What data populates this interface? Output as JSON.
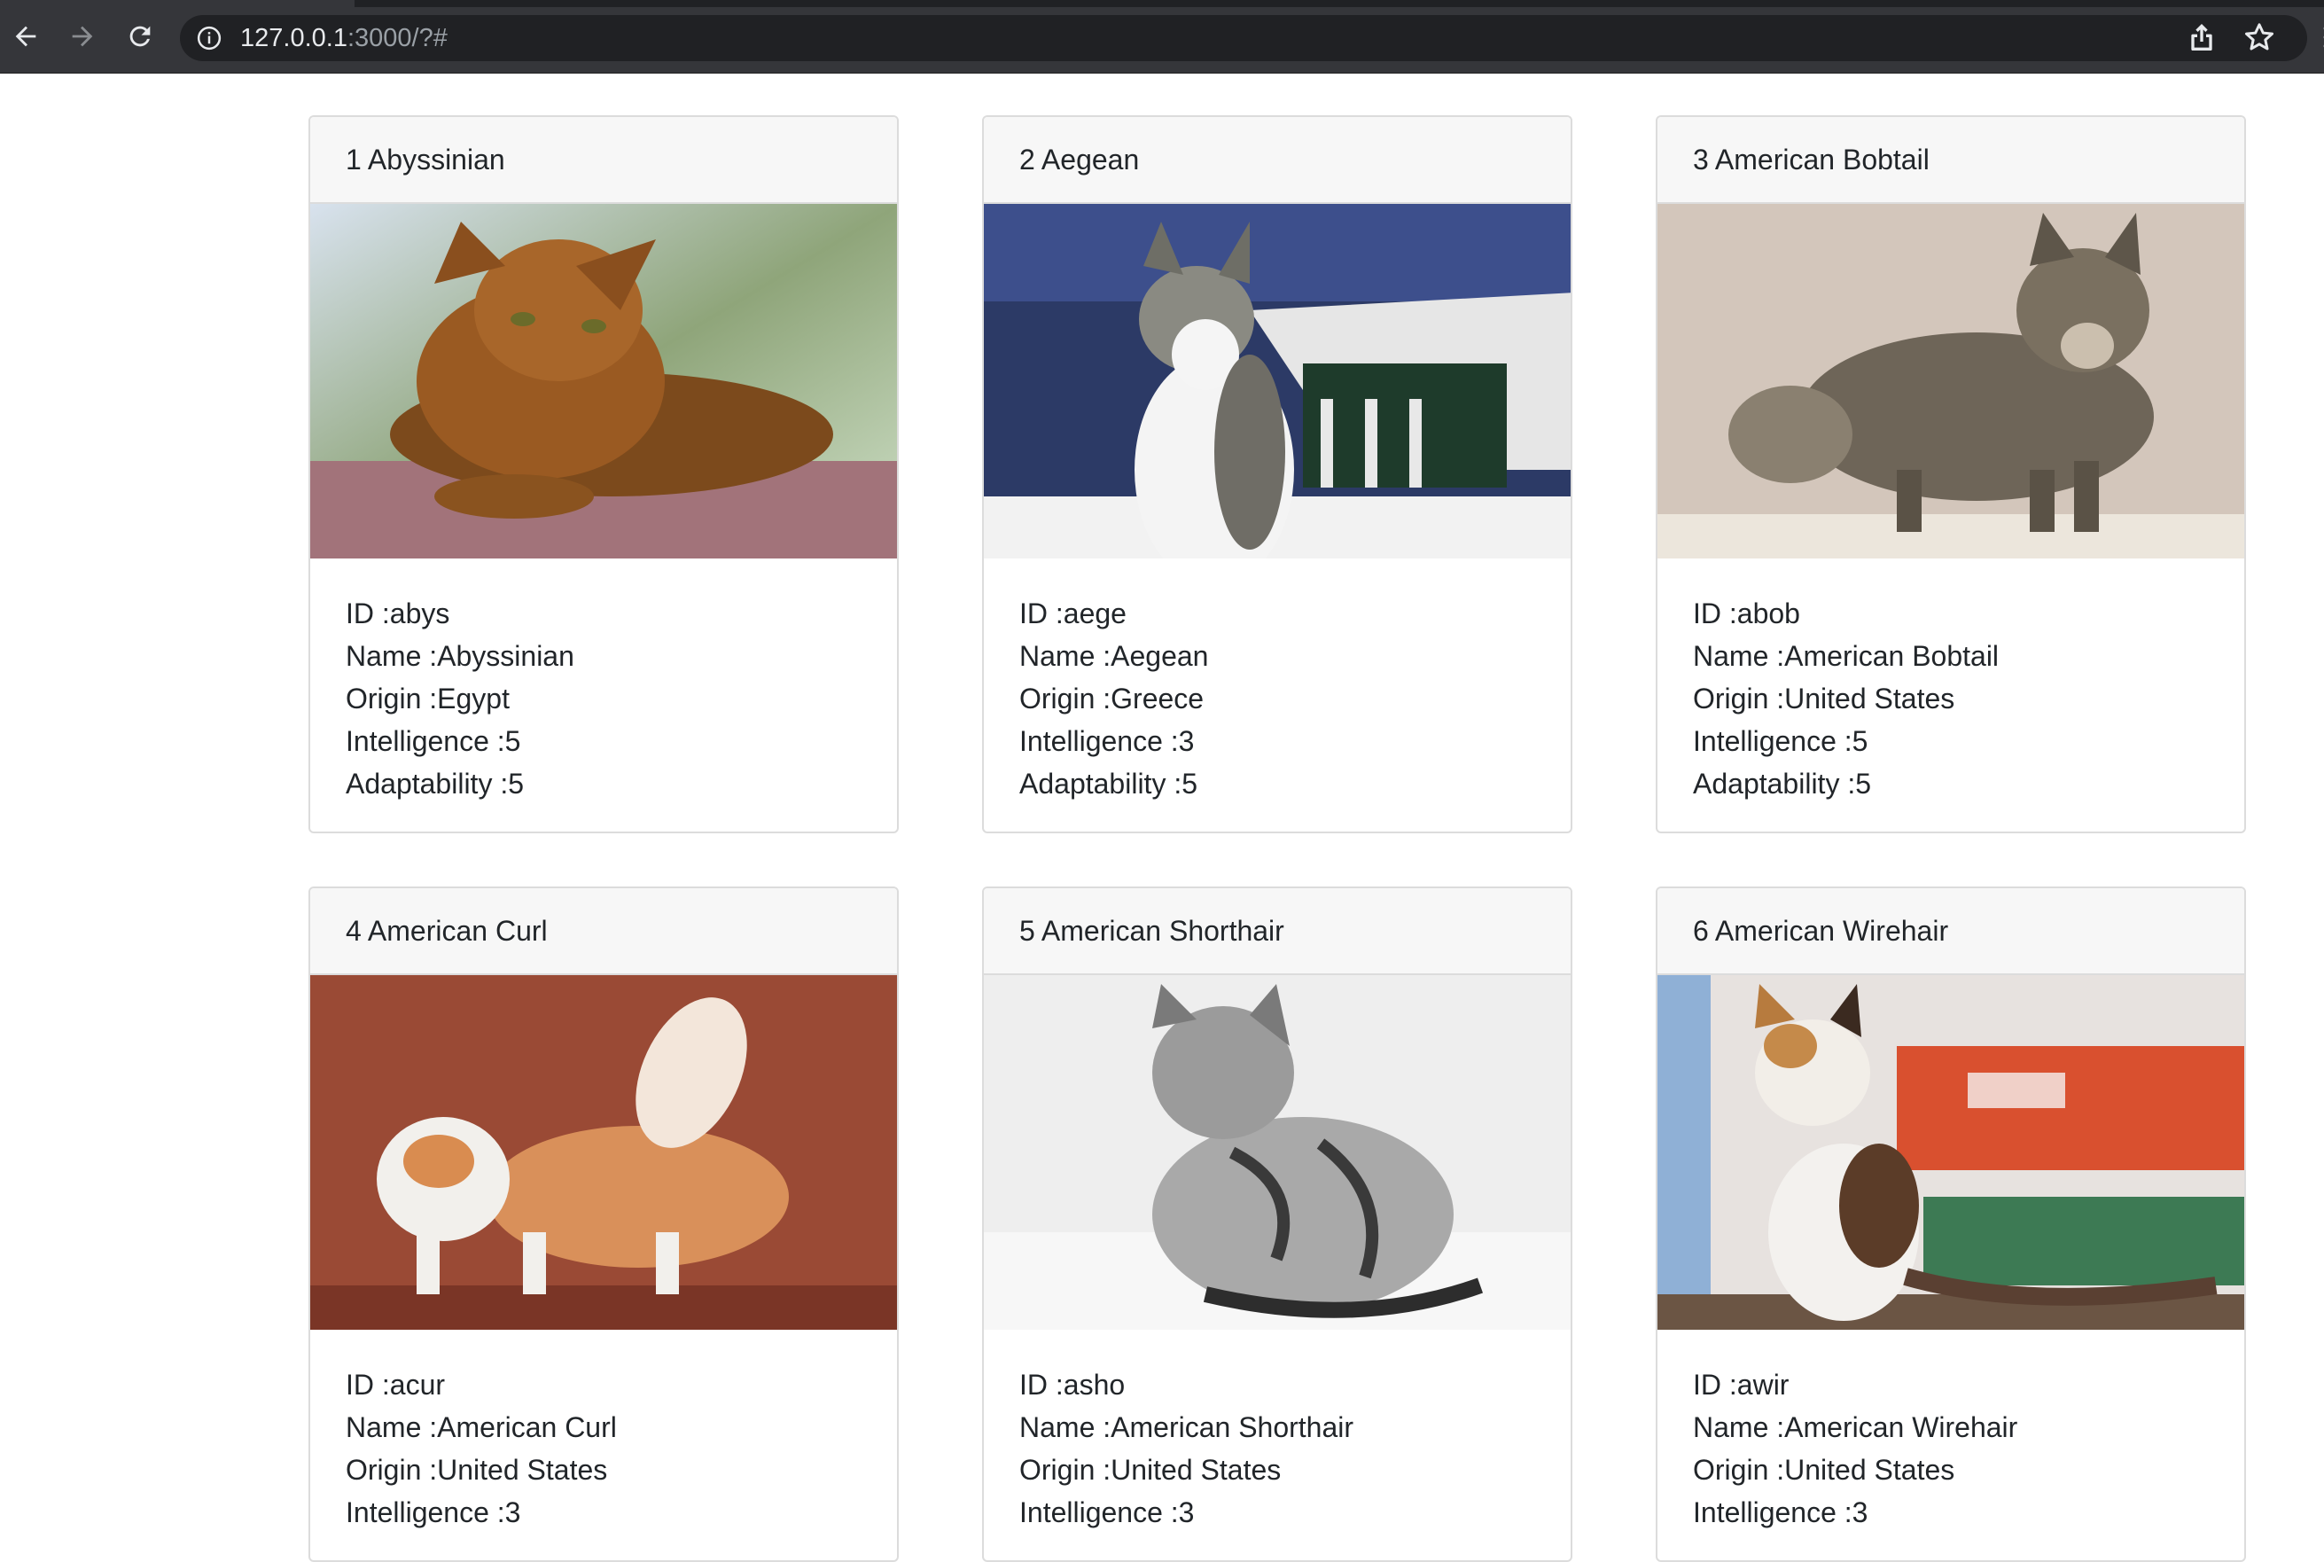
{
  "browser": {
    "url_host": "127.0.0.1",
    "url_rest": ":3000/?#"
  },
  "cards": [
    {
      "title": "1 Abyssinian",
      "image_desc_icon": "cat-photo",
      "id_line": "ID :abys",
      "name_line": "Name :Abyssinian",
      "origin_line": "Origin :Egypt",
      "intelligence_line": "Intelligence :5",
      "adaptability_line": "Adaptability :5"
    },
    {
      "title": "2 Aegean",
      "image_desc_icon": "cat-photo",
      "id_line": "ID :aege",
      "name_line": "Name :Aegean",
      "origin_line": "Origin :Greece",
      "intelligence_line": "Intelligence :3",
      "adaptability_line": "Adaptability :5"
    },
    {
      "title": "3 American Bobtail",
      "image_desc_icon": "cat-photo",
      "id_line": "ID :abob",
      "name_line": "Name :American Bobtail",
      "origin_line": "Origin :United States",
      "intelligence_line": "Intelligence :5",
      "adaptability_line": "Adaptability :5"
    },
    {
      "title": "4 American Curl",
      "image_desc_icon": "cat-photo",
      "id_line": "ID :acur",
      "name_line": "Name :American Curl",
      "origin_line": "Origin :United States",
      "intelligence_line": "Intelligence :3",
      "adaptability_line": ""
    },
    {
      "title": "5 American Shorthair",
      "image_desc_icon": "cat-photo",
      "id_line": "ID :asho",
      "name_line": "Name :American Shorthair",
      "origin_line": "Origin :United States",
      "intelligence_line": "Intelligence :3",
      "adaptability_line": ""
    },
    {
      "title": "6 American Wirehair",
      "image_desc_icon": "cat-photo",
      "id_line": "ID :awir",
      "name_line": "Name :American Wirehair",
      "origin_line": "Origin :United States",
      "intelligence_line": "Intelligence :3",
      "adaptability_line": ""
    }
  ],
  "colors": {
    "chrome_bg": "#35363a",
    "omnibox_bg": "#202124",
    "card_border": "#dcdcdc",
    "card_header_bg": "#f7f7f7",
    "text": "#212529"
  }
}
